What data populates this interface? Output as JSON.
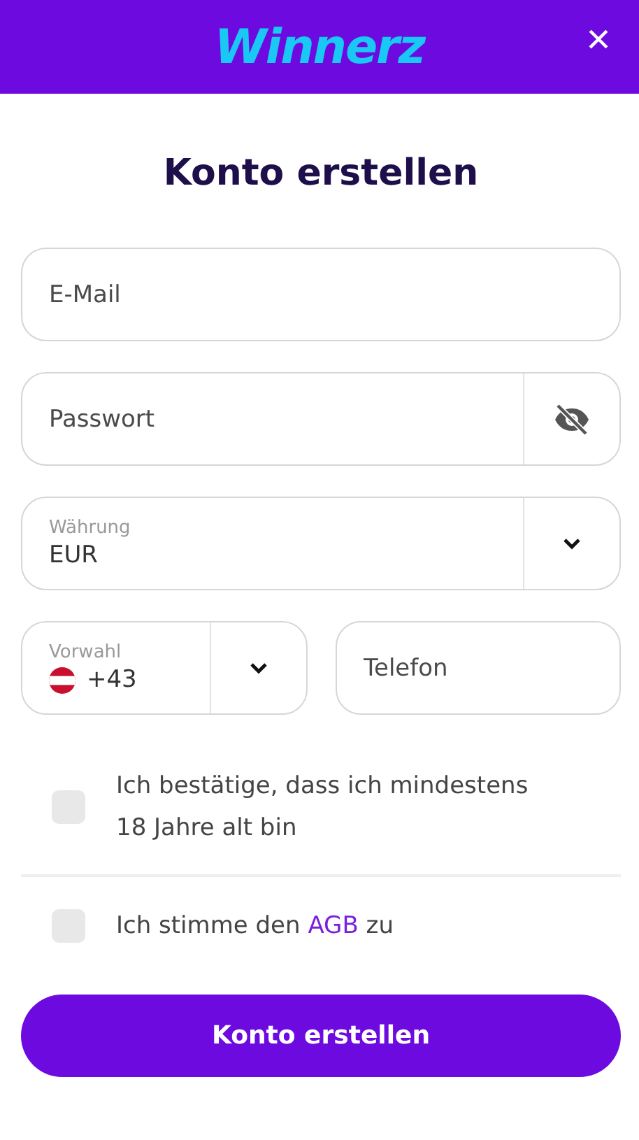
{
  "header": {
    "logo": "Winnerz",
    "close": "×"
  },
  "title": "Konto erstellen",
  "email": {
    "placeholder": "E-Mail"
  },
  "password": {
    "placeholder": "Passwort"
  },
  "currency": {
    "label": "Währung",
    "value": "EUR"
  },
  "dial_code": {
    "label": "Vorwahl",
    "value": "+43"
  },
  "phone": {
    "placeholder": "Telefon"
  },
  "checks": [
    {
      "checked": false,
      "text": "Ich bestätige, dass ich mindestens 18 Jahre alt bin"
    },
    {
      "checked": false,
      "text": "Ich stimme den ",
      "link": "AGB",
      "after": " zu"
    }
  ],
  "submit": "Konto erstellen"
}
